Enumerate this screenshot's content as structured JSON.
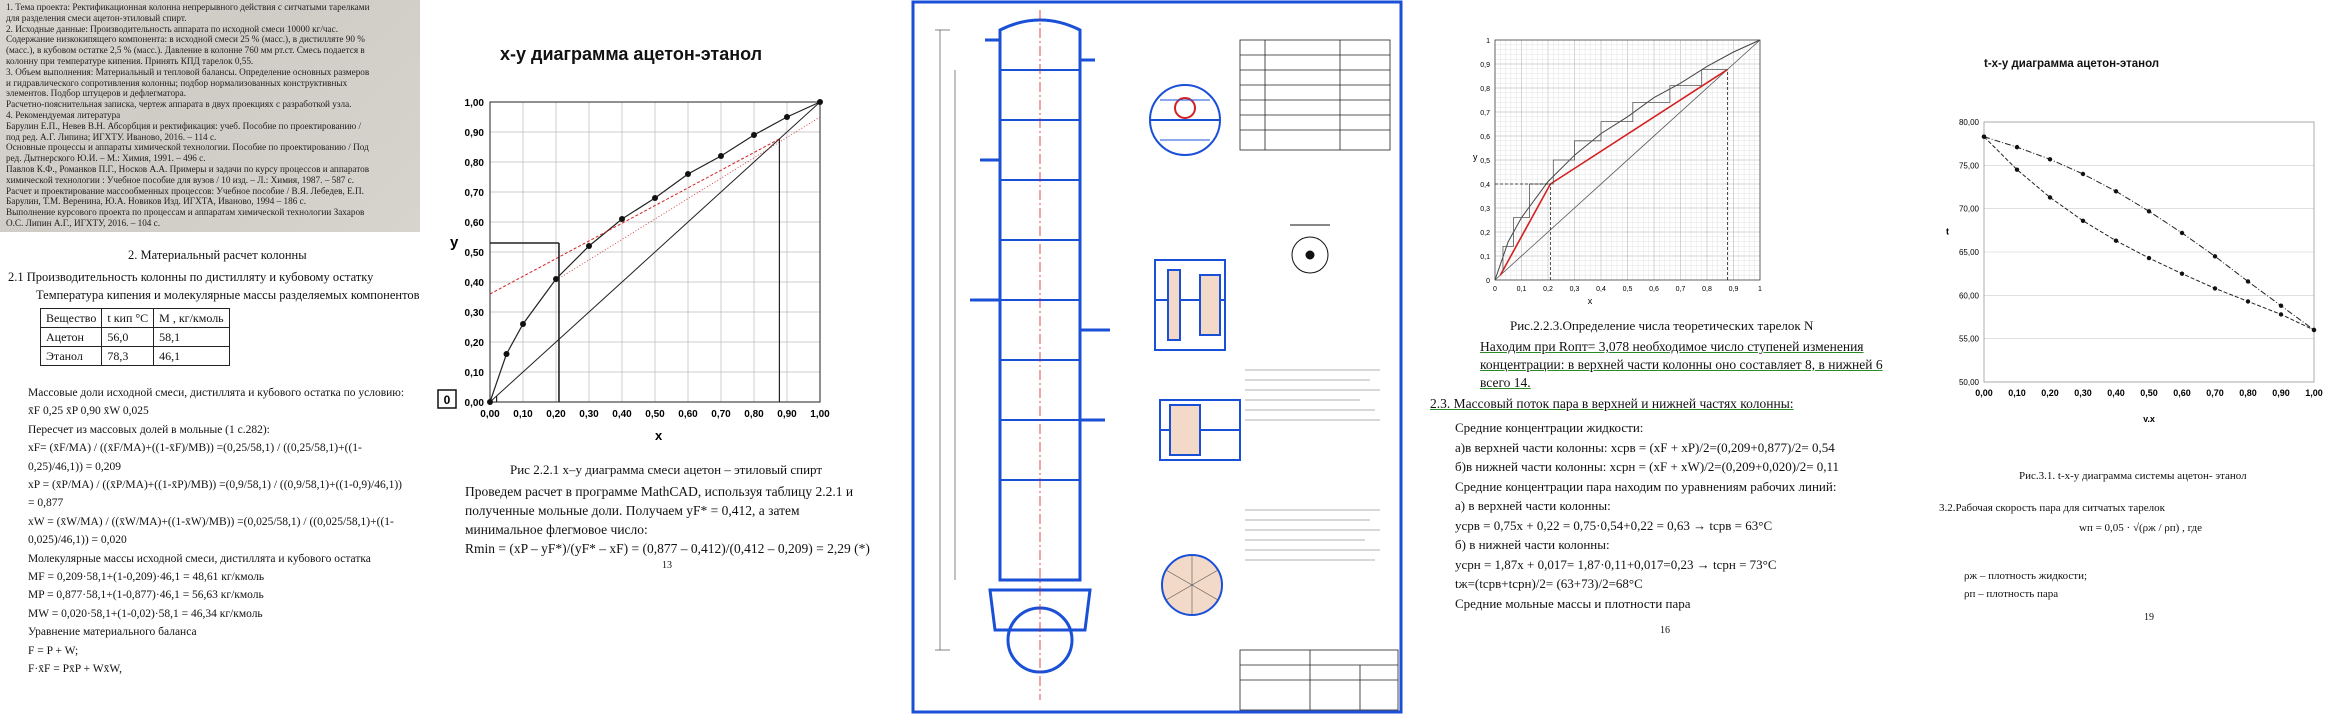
{
  "p1": {
    "scan_lines": [
      "1. Тема проекта: Ректификационная колонна непрерывного действия с ситчатыми тарелками",
      "для разделения смеси ацетон-этиловый спирт.",
      "2. Исходные данные: Производительность аппарата по исходной смеси 10000 кг/час.",
      "Содержание низкокипящего компонента: в исходной смеси 25 % (масс.), в дистилляте 90 %",
      "(масс.), в кубовом остатке 2,5 % (масс.). Давление в колонне 760 мм рт.ст. Смесь подается в",
      "колонну при температуре кипения. Принять КПД тарелок 0,55.",
      "3. Объем выполнения: Материальный и тепловой балансы. Определение основных размеров",
      "и гидравлического сопротивления колонны; подбор нормализованных конструктивных",
      "элементов. Подбор штуцеров и дефлегматора.",
      "Расчетно-пояснительная записка, чертеж аппарата в двух проекциях с разработкой узла.",
      "4. Рекомендуемая литература",
      "Барулин Е.П., Невев В.Н. Абсорбция и ректификация: учеб. Пособие по проектированию /",
      "под ред. А.Г. Липина; ИГХТУ. Иваново, 2016. – 114 с.",
      "Основные процессы и аппараты химической технологии. Пособие по проектированию / Под",
      "ред. Дытнерского Ю.И. – М.: Химия, 1991. – 496 с.",
      "Павлов К.Ф., Романков П.Г., Носков А.А. Примеры и задачи по курсу процессов и аппаратов",
      "химической технологии : Учебное пособие для вузов / 10 изд. – Л.: Химия, 1987. – 587 с.",
      "Расчет и проектирование массообменных процессов: Учебное пособие / В.Я. Лебедев, Е.П.",
      "Барулин, Т.М. Веренина, Ю.А. Новиков Изд. ИГХТА, Иваново, 1994 – 186 с.",
      "Выполнение курсового проекта по процессам и аппаратам химической технологии Захаров",
      "О.С. Липин А.Г., ИГХТУ, 2016. – 104 с."
    ],
    "section_title": "2. Материальный расчет колонны",
    "subsection": "2.1    Производительность колонны по дистилляту и кубовому остатку",
    "table_caption": "Температура кипения и молекулярные массы разделяемых компонентов",
    "table_head": [
      "Вещество",
      "t кип °С",
      "M , кг/кмоль"
    ],
    "table_rows": [
      [
        "Ацетон",
        "56,0",
        "58,1"
      ],
      [
        "Этанол",
        "78,3",
        "46,1"
      ]
    ],
    "lines": [
      "Массовые доли исходной смеси, дистиллята и кубового  остатка по условию:",
      "x̄F  0,25    x̄P  0,90    x̄W  0,025",
      "Пересчет из массовых долей в мольные (1 с.282):",
      "xF= (x̄F/MA) / ((x̄F/MA)+((1-x̄F)/MB)) =(0,25/58,1) / ((0,25/58,1)+((1-",
      "0,25)/46,1)) = 0,209",
      "xP = (x̄P/MA) / ((x̄P/MA)+((1-x̄P)/MB)) =(0,9/58,1) / ((0,9/58,1)+((1-0,9)/46,1))",
      "= 0,877",
      "xW = (x̄W/MA) / ((x̄W/MA)+((1-x̄W)/MB)) =(0,025/58,1) / ((0,025/58,1)+((1-",
      "0,025)/46,1)) = 0,020",
      "Молекулярные массы исходной смеси, дистиллята и кубового остатка",
      "MF = 0,209·58,1+(1-0,209)·46,1 = 48,61 кг/кмоль",
      "MP = 0,877·58,1+(1-0,877)·46,1 = 56,63 кг/кмоль",
      "MW = 0,020·58,1+(1-0,02)·58,1 = 46,34 кг/кмоль",
      "Уравнение материального баланса",
      "F = P + W;",
      "F·x̄F = Px̄P + Wx̄W,"
    ]
  },
  "p2": {
    "title": "x-y диаграмма ацетон-этанол",
    "ylabel": "y",
    "xlabel": "x",
    "origin_label": "0",
    "yticks": [
      "1,00",
      "0,90",
      "0,80",
      "0,70",
      "0,60",
      "0,50",
      "0,40",
      "0,30",
      "0,20",
      "0,10",
      "0,00"
    ],
    "xticks": [
      "0,00",
      "0,10",
      "0,20",
      "0,30",
      "0,40",
      "0,50",
      "0,60",
      "0,70",
      "0,80",
      "0,90",
      "1,00"
    ],
    "caption": "Рис 2.2.1 x–y диаграмма смеси ацетон – этиловый спирт",
    "text_lines": [
      "Проведем расчет в программе MathCAD, используя таблицу 2.2.1 и",
      "полученные мольные доли. Получаем yF* = 0,412, а затем",
      "минимальное флегмовое число:",
      "Rmin = (xP – yF*)/(yF* – xF) = (0,877 – 0,412)/(0,412 – 0,209) = 2,29  (*)"
    ],
    "page_number": "13"
  },
  "p4": {
    "yticks": [
      "1",
      "0,9",
      "0,8",
      "0,7",
      "0,6",
      "0,5",
      "0,4",
      "0,3",
      "0,2",
      "0,1",
      "0"
    ],
    "xticks": [
      "0",
      "0,1",
      "0,2",
      "0,3",
      "0,4",
      "0,5",
      "0,6",
      "0,7",
      "0,8",
      "0,9",
      "1"
    ],
    "xlabel": "x",
    "ylabel": "y",
    "caption": "Рис.2.2.3.Определение числа теоретических тарелок N",
    "text_lines": [
      "Находим  при  Rопт= 3,078 необходимое  число  ступеней изменения",
      "концентрации: в  верхней части  колонны оно  составляет 8, в  нижней 6",
      "всего 14."
    ],
    "section": "2.3. Массовый поток пара в верхней и нижней частях колонны:",
    "lines": [
      "Средние концентрации жидкости:",
      "а)в  верхней части колонны: xсрв = (xF + xP)/2=(0,209+0,877)/2= 0,54",
      "б)в  нижней части колонны: xсрн = (xF + xW)/2=(0,209+0,020)/2= 0,11",
      "Средние концентрации пара находим по уравнениям рабочих линий:",
      "а)  в  верхней  части  колонны:",
      "yсрв = 0,75x + 0,22 = 0,75·0,54+0,22 = 0,63 → tсрв = 63°С",
      "б)  в  нижней  части  колонны:",
      "yсрн = 1,87x + 0,017= 1,87·0,11+0,017=0,23 → tсрн = 73°С",
      "tж=(tсрв+tсрн)/2= (63+73)/2=68°С",
      "Средние  мольные  массы  и  плотности  пара"
    ],
    "page_number": "16"
  },
  "p5": {
    "title": "t-x-y диаграмма ацетон-этанол",
    "ylabel": "t",
    "xlabel": "y,x",
    "yticks": [
      "80,00",
      "75,00",
      "70,00",
      "65,00",
      "60,00",
      "55,00",
      "50,00"
    ],
    "xticks": [
      "0,00",
      "0,10",
      "0,20",
      "0,30",
      "0,40",
      "0,50",
      "0,60",
      "0,70",
      "0,80",
      "0,90",
      "1,00"
    ],
    "caption": "Рис.3.1. t-x-y диаграмма системы ацетон- этанол",
    "section": "3.2.Рабочая скорость пара для ситчатых тарелок",
    "formula": "wп = 0,05 · √(ρж / ρп) , где",
    "defs": [
      "ρж – плотность жидкости;",
      "ρп – плотность пара"
    ],
    "page_number": "19"
  },
  "colors": {
    "blue": "#1a4fd8",
    "red": "#d42020",
    "green": "#2a8a2a"
  }
}
